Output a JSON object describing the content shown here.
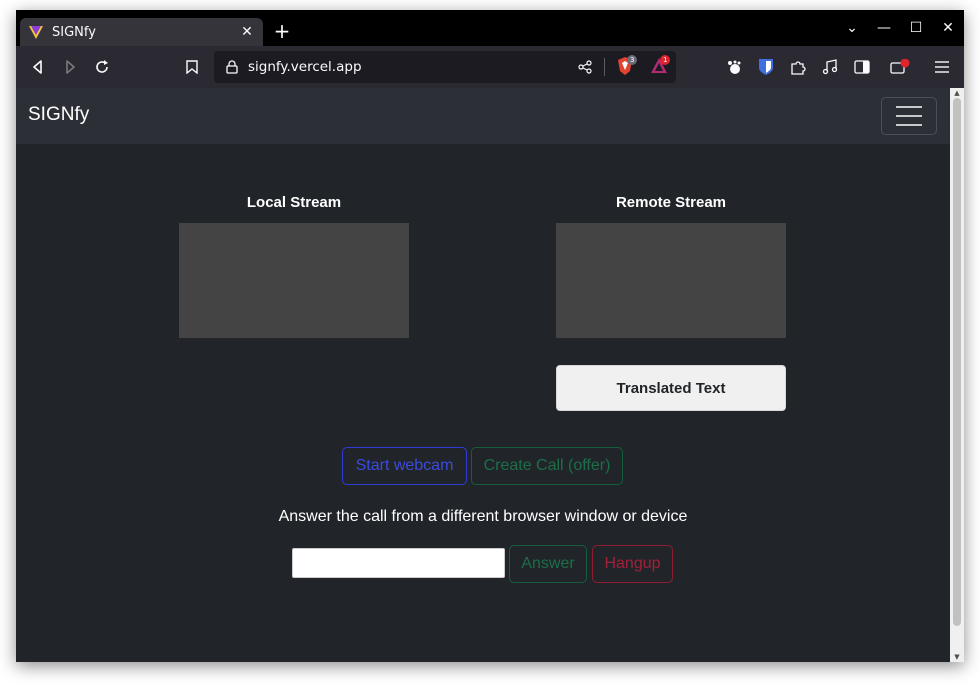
{
  "browser": {
    "tab_title": "SIGNfy",
    "new_tab_label": "+",
    "url": "signfy.vercel.app",
    "brave_shields_count": "3",
    "rewards_count": "1",
    "controls": {
      "minimize": "—",
      "maximize": "☐",
      "close": "✕",
      "tab_list": "⌄"
    }
  },
  "navbar": {
    "brand": "SIGNfy"
  },
  "streams": {
    "local_label": "Local Stream",
    "remote_label": "Remote Stream",
    "translated_label": "Translated Text"
  },
  "actions": {
    "start_webcam": "Start webcam",
    "create_call": "Create Call (offer)",
    "instructions": "Answer the call from a different browser window or device",
    "answer_input_value": "",
    "answer": "Answer",
    "hangup": "Hangup"
  },
  "colors": {
    "page_bg": "#212529",
    "navbar_bg": "#2c3036",
    "primary": "#3b4ae0",
    "success": "#1c6e48",
    "danger": "#a3203b"
  }
}
